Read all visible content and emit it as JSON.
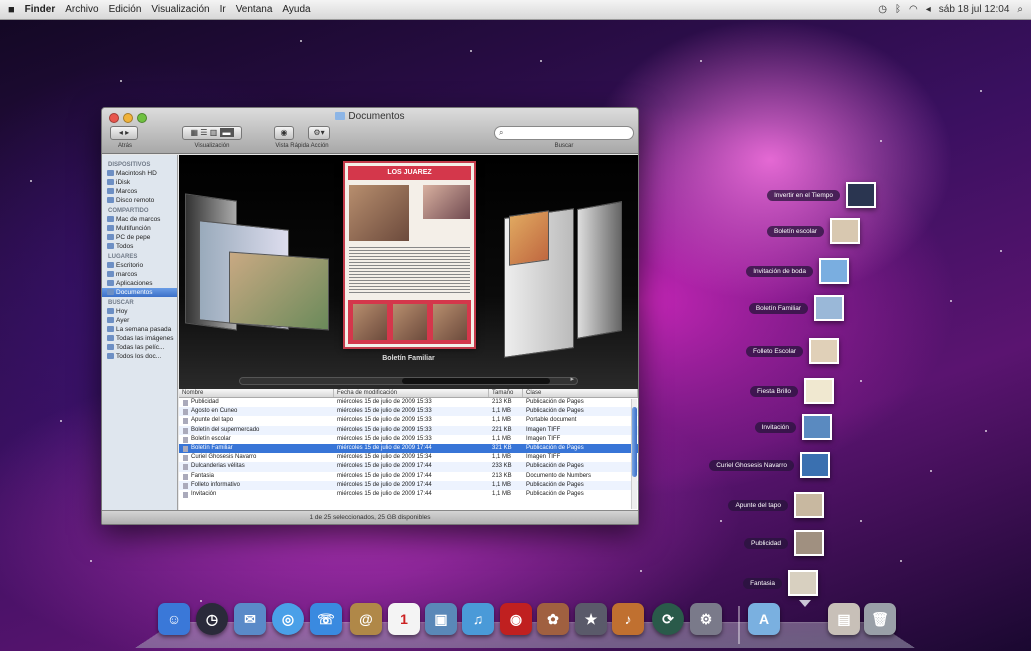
{
  "menubar": {
    "apple": "",
    "items": [
      "Finder",
      "Archivo",
      "Edición",
      "Visualización",
      "Ir",
      "Ventana",
      "Ayuda"
    ],
    "status": {
      "icons": [
        "time-machine-icon",
        "bluetooth-icon",
        "wifi-icon",
        "volume-icon"
      ],
      "datetime": "sáb 18 jul 12:04",
      "spotlight": "search-icon"
    }
  },
  "finder": {
    "title": "Documentos",
    "toolbar": {
      "nav_label": "Atrás",
      "view_label": "Visualización",
      "quicklook_label": "Vista Rápida  Acción",
      "search_label": "Buscar",
      "search_placeholder": ""
    },
    "sidebar": [
      {
        "heading": "DISPOSITIVOS",
        "items": [
          "Macintosh HD",
          "iDisk",
          "Marcos",
          "Disco remoto"
        ]
      },
      {
        "heading": "COMPARTIDO",
        "items": [
          "Mac de marcos",
          "Multifunción",
          "PC de pepe",
          "Todos"
        ]
      },
      {
        "heading": "LUGARES",
        "items": [
          "Escritorio",
          "marcos",
          "Aplicaciones",
          "Documentos"
        ]
      },
      {
        "heading": "BUSCAR",
        "items": [
          "Hoy",
          "Ayer",
          "La semana pasada",
          "Todas las imágenes",
          "Todas las pelíc...",
          "Todos los doc..."
        ]
      }
    ],
    "selected_sidebar": "Documentos",
    "coverflow": {
      "caption": "Boletín Familiar",
      "cover_banner": "LOS JUAREZ"
    },
    "list": {
      "columns": [
        "Nombre",
        "Fecha de modificación",
        "Tamaño",
        "Clase"
      ],
      "rows": [
        {
          "name": "Publicidad",
          "date": "miércoles 15 de julio de 2009 15:33",
          "size": "213 KB",
          "kind": "Publicación de Pages"
        },
        {
          "name": "Agosto en Cuneo",
          "date": "miércoles 15 de julio de 2009 15:33",
          "size": "1,1 MB",
          "kind": "Publicación de Pages"
        },
        {
          "name": "Apunte del tapo",
          "date": "miércoles 15 de julio de 2009 15:33",
          "size": "1,1 MB",
          "kind": "Portable document"
        },
        {
          "name": "Boletín del supermercado",
          "date": "miércoles 15 de julio de 2009 15:33",
          "size": "221 KB",
          "kind": "Imagen TIFF"
        },
        {
          "name": "Boletín escolar",
          "date": "miércoles 15 de julio de 2009 15:33",
          "size": "1,1 MB",
          "kind": "Imagen TIFF"
        },
        {
          "name": "Boletín Familiar",
          "date": "miércoles 15 de julio de 2009 17:44",
          "size": "321 KB",
          "kind": "Publicación de Pages"
        },
        {
          "name": "Curiel Ghosesis Navarro",
          "date": "miércoles 15 de julio de 2009 15:34",
          "size": "1,1 MB",
          "kind": "Imagen TIFF"
        },
        {
          "name": "Dulcanderias vélitas",
          "date": "miércoles 15 de julio de 2009 17:44",
          "size": "233 KB",
          "kind": "Publicación de Pages"
        },
        {
          "name": "Fantasia",
          "date": "miércoles 15 de julio de 2009 17:44",
          "size": "213 KB",
          "kind": "Documento de Numbers"
        },
        {
          "name": "Folleto informativo",
          "date": "miércoles 15 de julio de 2009 17:44",
          "size": "1,1 MB",
          "kind": "Publicación de Pages"
        },
        {
          "name": "Invitación",
          "date": "miércoles 15 de julio de 2009 17:44",
          "size": "1,1 MB",
          "kind": "Publicación de Pages"
        }
      ],
      "selected_index": 5
    },
    "status_text": "1 de 25 seleccionados, 25 GB disponibles"
  },
  "stack": [
    {
      "label": "Invertir en el Tiempo",
      "color": "#2a3550"
    },
    {
      "label": "Boletín escolar",
      "color": "#d8c8b0"
    },
    {
      "label": "Invitación de boda",
      "color": "#7aaee0"
    },
    {
      "label": "Boletín Familiar",
      "color": "#9ab8d8"
    },
    {
      "label": "Folleto Escolar",
      "color": "#e0d0b8"
    },
    {
      "label": "Fiesta Brillo",
      "color": "#f0e8d0"
    },
    {
      "label": "Invitación",
      "color": "#5a8ac0"
    },
    {
      "label": "Curiel Ghosesis Navarro",
      "color": "#3a70b0"
    },
    {
      "label": "Apunte del tapo",
      "color": "#c8b8a0"
    },
    {
      "label": "Publicidad",
      "color": "#a09080"
    },
    {
      "label": "Fantasia",
      "color": "#d8d0c0"
    }
  ],
  "dock": [
    {
      "name": "finder-icon",
      "color": "#3a78d8",
      "glyph": "☺"
    },
    {
      "name": "dashboard-icon",
      "color": "#2a2a3a",
      "glyph": "◷"
    },
    {
      "name": "mail-icon",
      "color": "#5a8ac8",
      "glyph": "✉"
    },
    {
      "name": "safari-icon",
      "color": "#4aa0e8",
      "glyph": "◎"
    },
    {
      "name": "ichat-icon",
      "color": "#3a8ae0",
      "glyph": "☏"
    },
    {
      "name": "address-book-icon",
      "color": "#b08848",
      "glyph": "@"
    },
    {
      "name": "ical-icon",
      "color": "#f4f4f4",
      "glyph": "1"
    },
    {
      "name": "preview-icon",
      "color": "#5a88b8",
      "glyph": "▣"
    },
    {
      "name": "itunes-icon",
      "color": "#4a9ad8",
      "glyph": "♫"
    },
    {
      "name": "photo-booth-icon",
      "color": "#c02020",
      "glyph": "◉"
    },
    {
      "name": "iphoto-icon",
      "color": "#a06040",
      "glyph": "✿"
    },
    {
      "name": "imovie-icon",
      "color": "#5a5a6a",
      "glyph": "★"
    },
    {
      "name": "garageband-icon",
      "color": "#c07030",
      "glyph": "♪"
    },
    {
      "name": "time-machine-icon",
      "color": "#2a5a4a",
      "glyph": "⟳"
    },
    {
      "name": "system-preferences-icon",
      "color": "#7a7a8a",
      "glyph": "⚙"
    },
    {
      "name": "applications-folder-icon",
      "color": "#7ab0e0",
      "glyph": "A"
    },
    {
      "name": "documents-stack-icon",
      "color": "#c8c0b8",
      "glyph": "▤"
    },
    {
      "name": "trash-icon",
      "color": "#9aa0a8",
      "glyph": "🗑"
    }
  ]
}
